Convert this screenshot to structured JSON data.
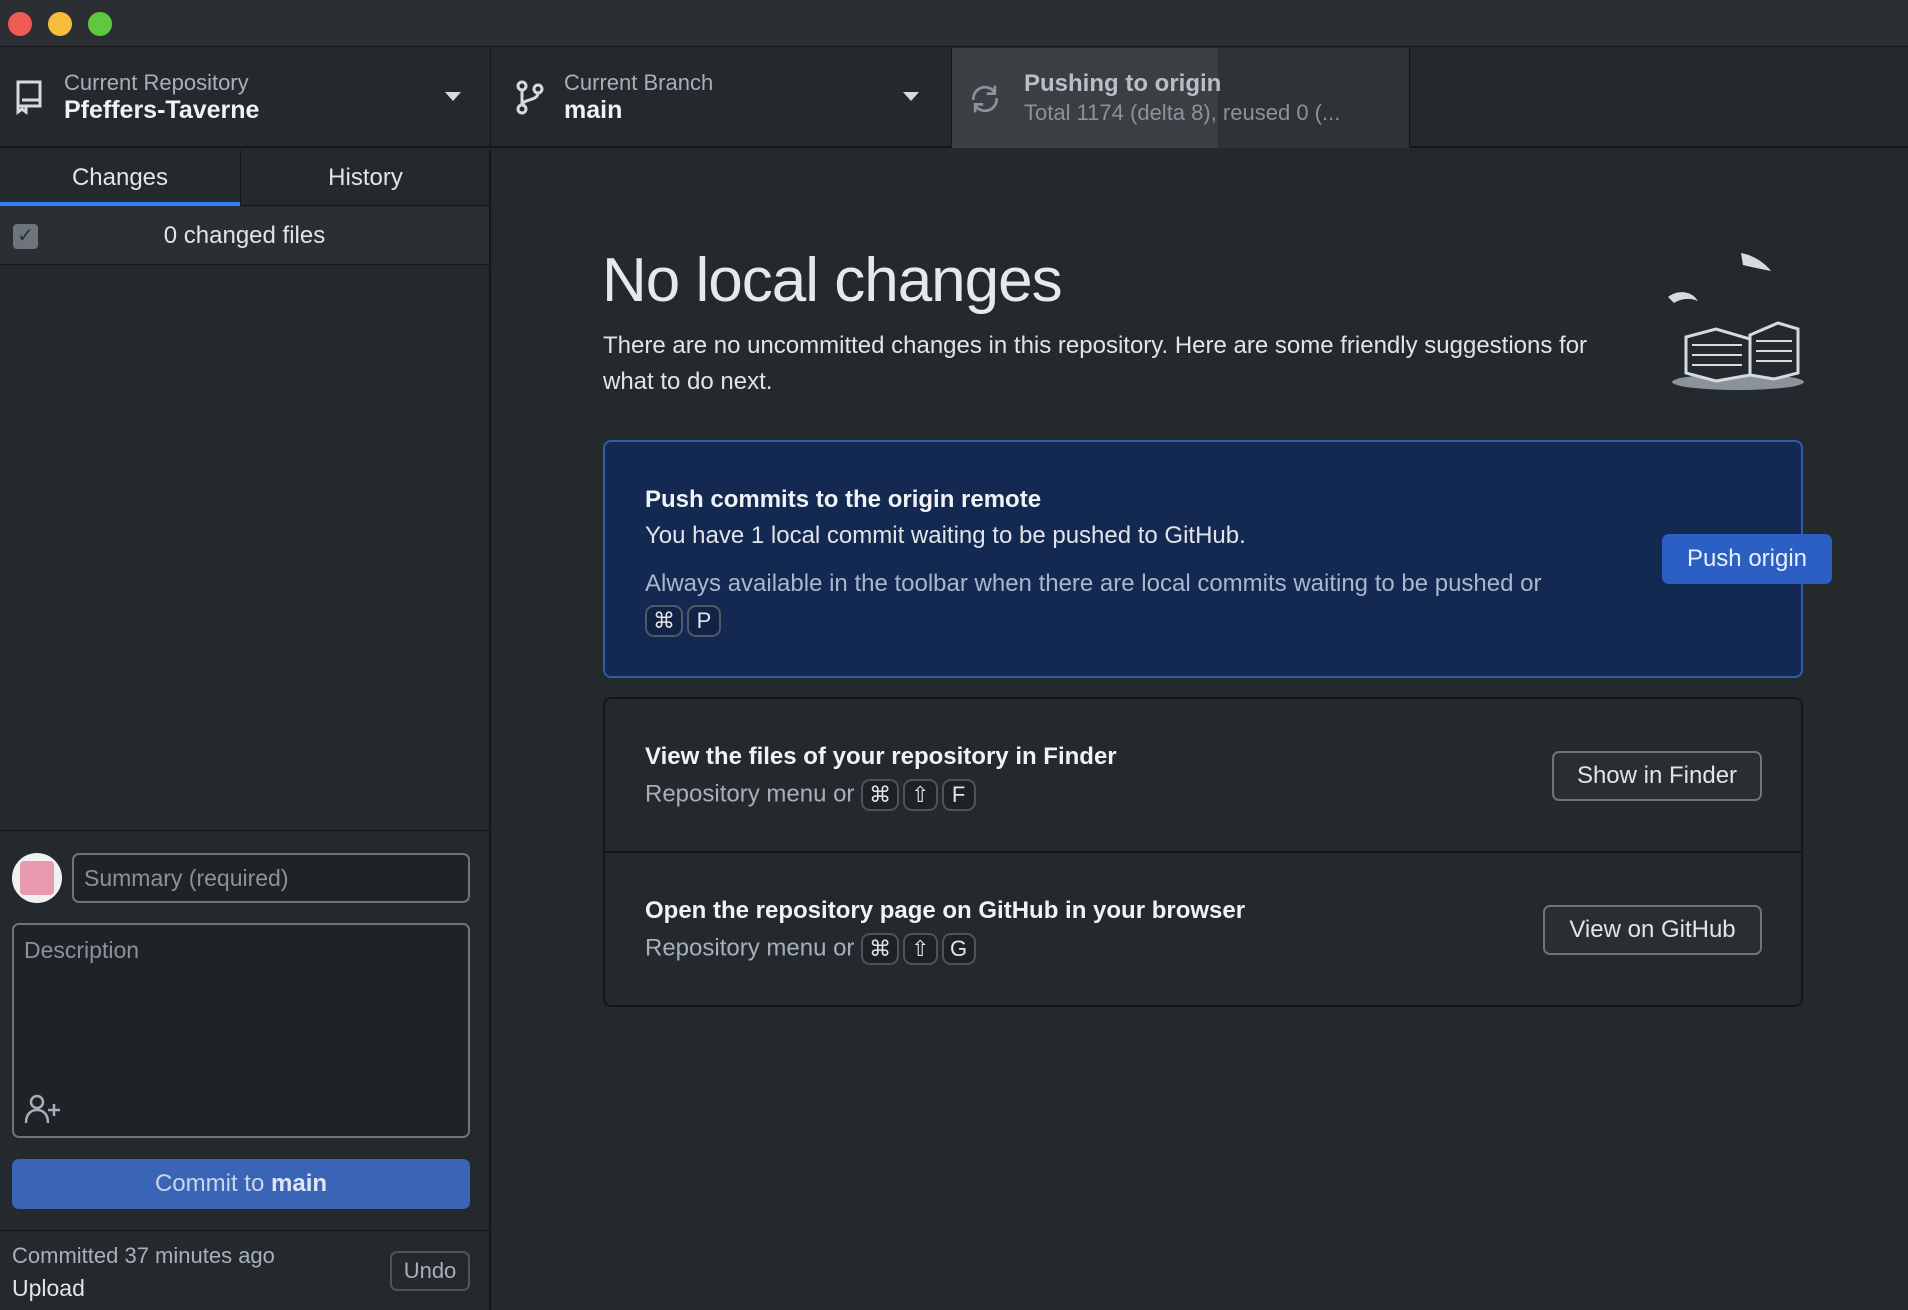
{
  "toolbar": {
    "repository": {
      "label": "Current Repository",
      "value": "Pfeffers-Taverne"
    },
    "branch": {
      "label": "Current Branch",
      "value": "main"
    },
    "push": {
      "label": "Pushing to origin",
      "value": "Total 1174 (delta 8), reused 0 (...",
      "progress": 0.58
    }
  },
  "sidebar": {
    "tabs": [
      {
        "label": "Changes",
        "selected": true
      },
      {
        "label": "History",
        "selected": false
      }
    ],
    "changed_files": "0 changed files",
    "commit": {
      "summary_placeholder": "Summary (required)",
      "description_placeholder": "Description",
      "button_prefix": "Commit to",
      "button_branch": "main"
    },
    "last_commit": {
      "time": "Committed 37 minutes ago",
      "message": "Upload",
      "undo_label": "Undo"
    }
  },
  "main": {
    "title": "No local changes",
    "subtitle": "There are no uncommitted changes in this repository. Here are some friendly suggestions for what to do next.",
    "push_card": {
      "title": "Push commits to the origin remote",
      "description": "You have 1 local commit waiting to be pushed to GitHub.",
      "hint": "Always available in the toolbar when there are local commits waiting to be pushed or",
      "keys": [
        "⌘",
        "P"
      ],
      "button": "Push origin"
    },
    "finder_row": {
      "title": "View the files of your repository in Finder",
      "hint": "Repository menu or",
      "keys": [
        "⌘",
        "⇧",
        "F"
      ],
      "button": "Show in Finder"
    },
    "github_row": {
      "title": "Open the repository page on GitHub in your browser",
      "hint": "Repository menu or",
      "keys": [
        "⌘",
        "⇧",
        "G"
      ],
      "button": "View on GitHub"
    }
  },
  "colors": {
    "accent": "#2f81f7",
    "push_card_bg": "#142952",
    "commit_button": "#3a64b5"
  }
}
